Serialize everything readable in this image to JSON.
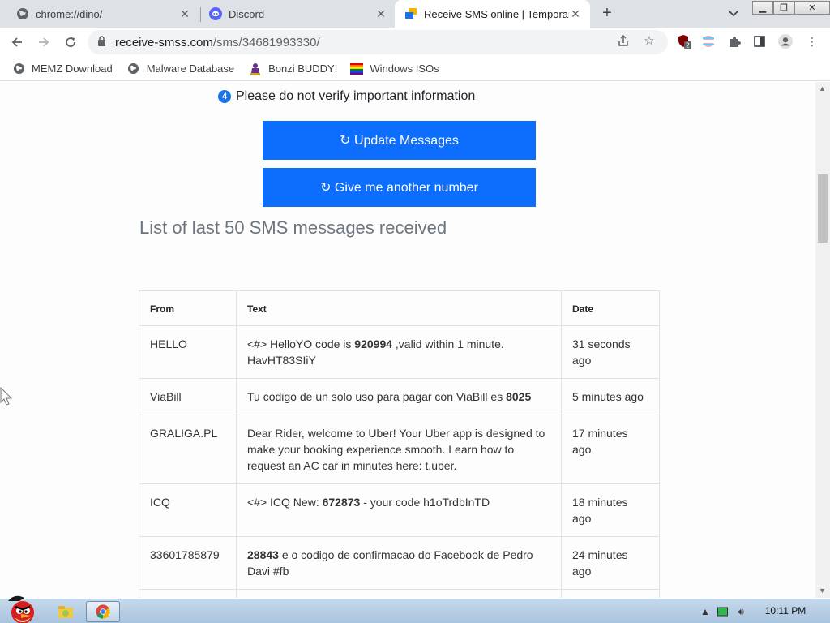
{
  "browser": {
    "tabs": [
      {
        "title": "chrome://dino/",
        "icon": "globe-icon",
        "active": false
      },
      {
        "title": "Discord",
        "icon": "discord-icon",
        "active": false
      },
      {
        "title": "Receive SMS online | Temporary",
        "icon": "sms-site-icon",
        "active": true
      }
    ],
    "url_host": "receive-smss.com",
    "url_path": "/sms/34681993330/",
    "extension_badge": "2",
    "bookmarks": [
      {
        "label": "MEMZ Download",
        "icon": "globe-icon"
      },
      {
        "label": "Malware Database",
        "icon": "globe-icon"
      },
      {
        "label": "Bonzi BUDDY!",
        "icon": "bonzi-icon"
      },
      {
        "label": "Windows ISOs",
        "icon": "rainbow-flag-icon"
      }
    ]
  },
  "page": {
    "notice_number": "4",
    "notice_text": "Please do not verify important information",
    "update_button": "↻ Update Messages",
    "another_number_button": "↻ Give me another number",
    "section_title": "List of last 50 SMS messages received",
    "table": {
      "headers": {
        "from": "From",
        "text": "Text",
        "date": "Date"
      },
      "rows": [
        {
          "from": "HELLO",
          "pre": "<#> HelloYO code is ",
          "code": "920994",
          "post": " ,valid within 1 minute. HavHT83SIiY",
          "date": "31 seconds ago"
        },
        {
          "from": "ViaBill",
          "pre": "Tu codigo de un solo uso para pagar con ViaBill es ",
          "code": "8025",
          "post": "",
          "date": "5 minutes ago"
        },
        {
          "from": "GRALIGA.PL",
          "pre": "Dear Rider, welcome to Uber! Your Uber app is designed to make your booking experience smooth. Learn how to request an AC car in minutes here: t.uber.",
          "code": "",
          "post": "",
          "date": "17 minutes ago"
        },
        {
          "from": "ICQ",
          "pre": "<#> ICQ New: ",
          "code": "672873",
          "post": " - your code h1oTrdbInTD",
          "date": "18 minutes ago"
        },
        {
          "from": "33601785879",
          "pre": "",
          "code": "28843",
          "post": " e o codigo de confirmacao do Facebook de Pedro Davi #fb",
          "date": "24 minutes ago"
        }
      ]
    }
  },
  "taskbar": {
    "clock": "10:11 PM"
  },
  "colors": {
    "button_blue": "#0d6efd",
    "tab_strip": "#dee1e6",
    "title_gray": "#6c757d"
  }
}
